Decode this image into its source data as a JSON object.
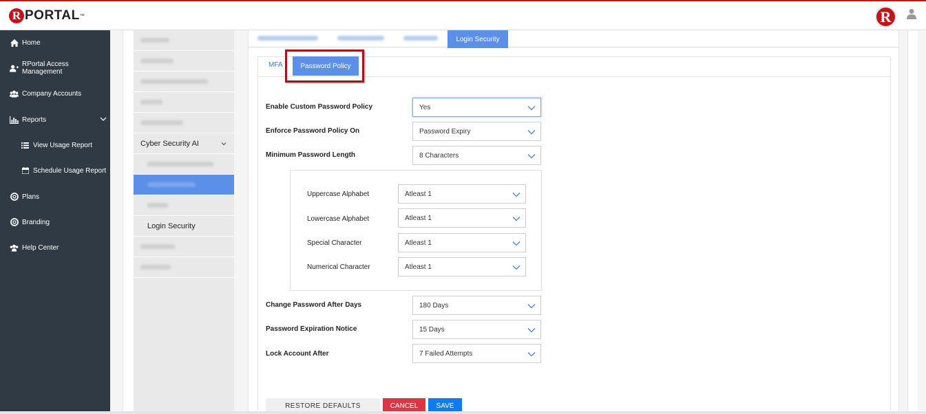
{
  "brand": {
    "logo_letter": "R",
    "logo_text": "PORTAL",
    "trademark": "™",
    "badge_letter": "R"
  },
  "colors": {
    "accent_red": "#c0161b",
    "nav_bg": "#2f3a45",
    "tab_blue": "#5b8fe8",
    "cancel_red": "#dc3545",
    "save_blue": "#0d7bf1"
  },
  "nav": {
    "home": "Home",
    "access": "RPortal Access Management",
    "accounts": "Company Accounts",
    "reports": "Reports",
    "view_usage": "View Usage Report",
    "schedule_usage": "Schedule Usage Report",
    "plans": "Plans",
    "branding": "Branding",
    "help": "Help Center"
  },
  "submenu": {
    "cyber": "Cyber Security AI",
    "login_security": "Login Security"
  },
  "tabs": {
    "login_security": "Login Security"
  },
  "subtabs": {
    "mfa": "MFA",
    "password_policy": "Password Policy"
  },
  "form": {
    "enable_label": "Enable Custom Password Policy",
    "enable_value": "Yes",
    "enforce_label": "Enforce Password Policy On",
    "enforce_value": "Password Expiry",
    "min_len_label": "Minimum Password Length",
    "min_len_value": "8 Characters",
    "uppercase_label": "Uppercase Alphabet",
    "uppercase_value": "Atleast 1",
    "lowercase_label": "Lowercase Alphabet",
    "lowercase_value": "Atleast 1",
    "special_label": "Special Character",
    "special_value": "Atleast 1",
    "numerical_label": "Numerical Character",
    "numerical_value": "Atleast 1",
    "change_label": "Change Password After Days",
    "change_value": "180 Days",
    "notice_label": "Password Expiration Notice",
    "notice_value": "15 Days",
    "lock_label": "Lock Account After",
    "lock_value": "7 Failed Attempts"
  },
  "buttons": {
    "restore": "RESTORE DEFAULTS",
    "cancel": "CANCEL",
    "save": "SAVE"
  }
}
